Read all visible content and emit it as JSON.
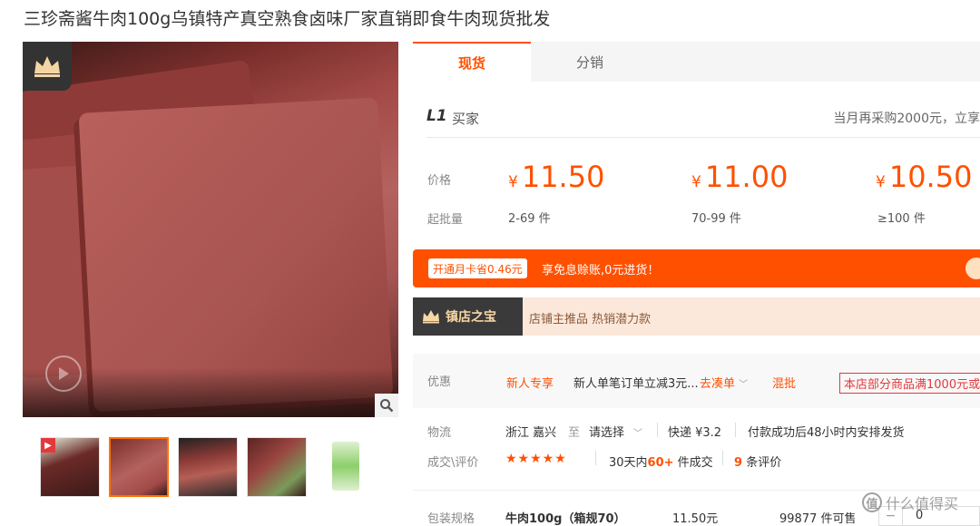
{
  "product": {
    "title": "三珍斋酱牛肉100g乌镇特产真空熟食卤味厂家直销即食牛肉现货批发"
  },
  "tabs": [
    {
      "label": "现货"
    },
    {
      "label": "分销"
    }
  ],
  "buyer": {
    "level_badge": "L1",
    "level_text": "买家",
    "monthly_tip": "当月再采购2000元，立享"
  },
  "pricing": {
    "price_label": "价格",
    "moq_label": "起批量",
    "currency": "¥",
    "tiers": [
      {
        "price": "11.50",
        "range": "2-69 件"
      },
      {
        "price": "11.00",
        "range": "70-99 件"
      },
      {
        "price": "10.50",
        "range": "≥100 件"
      }
    ]
  },
  "promo": {
    "tag": "开通月卡省0.46元",
    "text": "享免息赊账,0元进货！"
  },
  "treasure": {
    "title": "镇店之宝",
    "text": "店铺主推品  热销潜力款"
  },
  "offers": {
    "label": "优惠",
    "new_user": "新人专享",
    "description": "新人单笔订单立减3元...",
    "go_link": "去凑单",
    "mixed": "混批",
    "store_promo": "本店部分商品满1000元或"
  },
  "logistics": {
    "label": "物流",
    "origin": "浙江 嘉兴",
    "to": "至",
    "destination": "请选择",
    "express": "快递 ¥3.2",
    "shipping_note": "付款成功后48小时内安排发货"
  },
  "deals": {
    "label": "成交\\评价",
    "stars": "★★★★★",
    "sales_prefix": "30天内",
    "sales_count": "60+",
    "sales_suffix": "件成交",
    "review_count": "9",
    "review_suffix": "条评价"
  },
  "spec": {
    "label": "包装规格",
    "name": "牛肉100g（箱规70）",
    "price": "11.50元",
    "stock": "99877 件可售",
    "minus": "−",
    "qty": "0"
  },
  "watermark": {
    "logo_char": "值",
    "text": "什么值得买"
  },
  "colors": {
    "accent": "#ff5000",
    "treasure_bg": "#fbe8da",
    "treasure_dark": "#3a3a3a"
  }
}
